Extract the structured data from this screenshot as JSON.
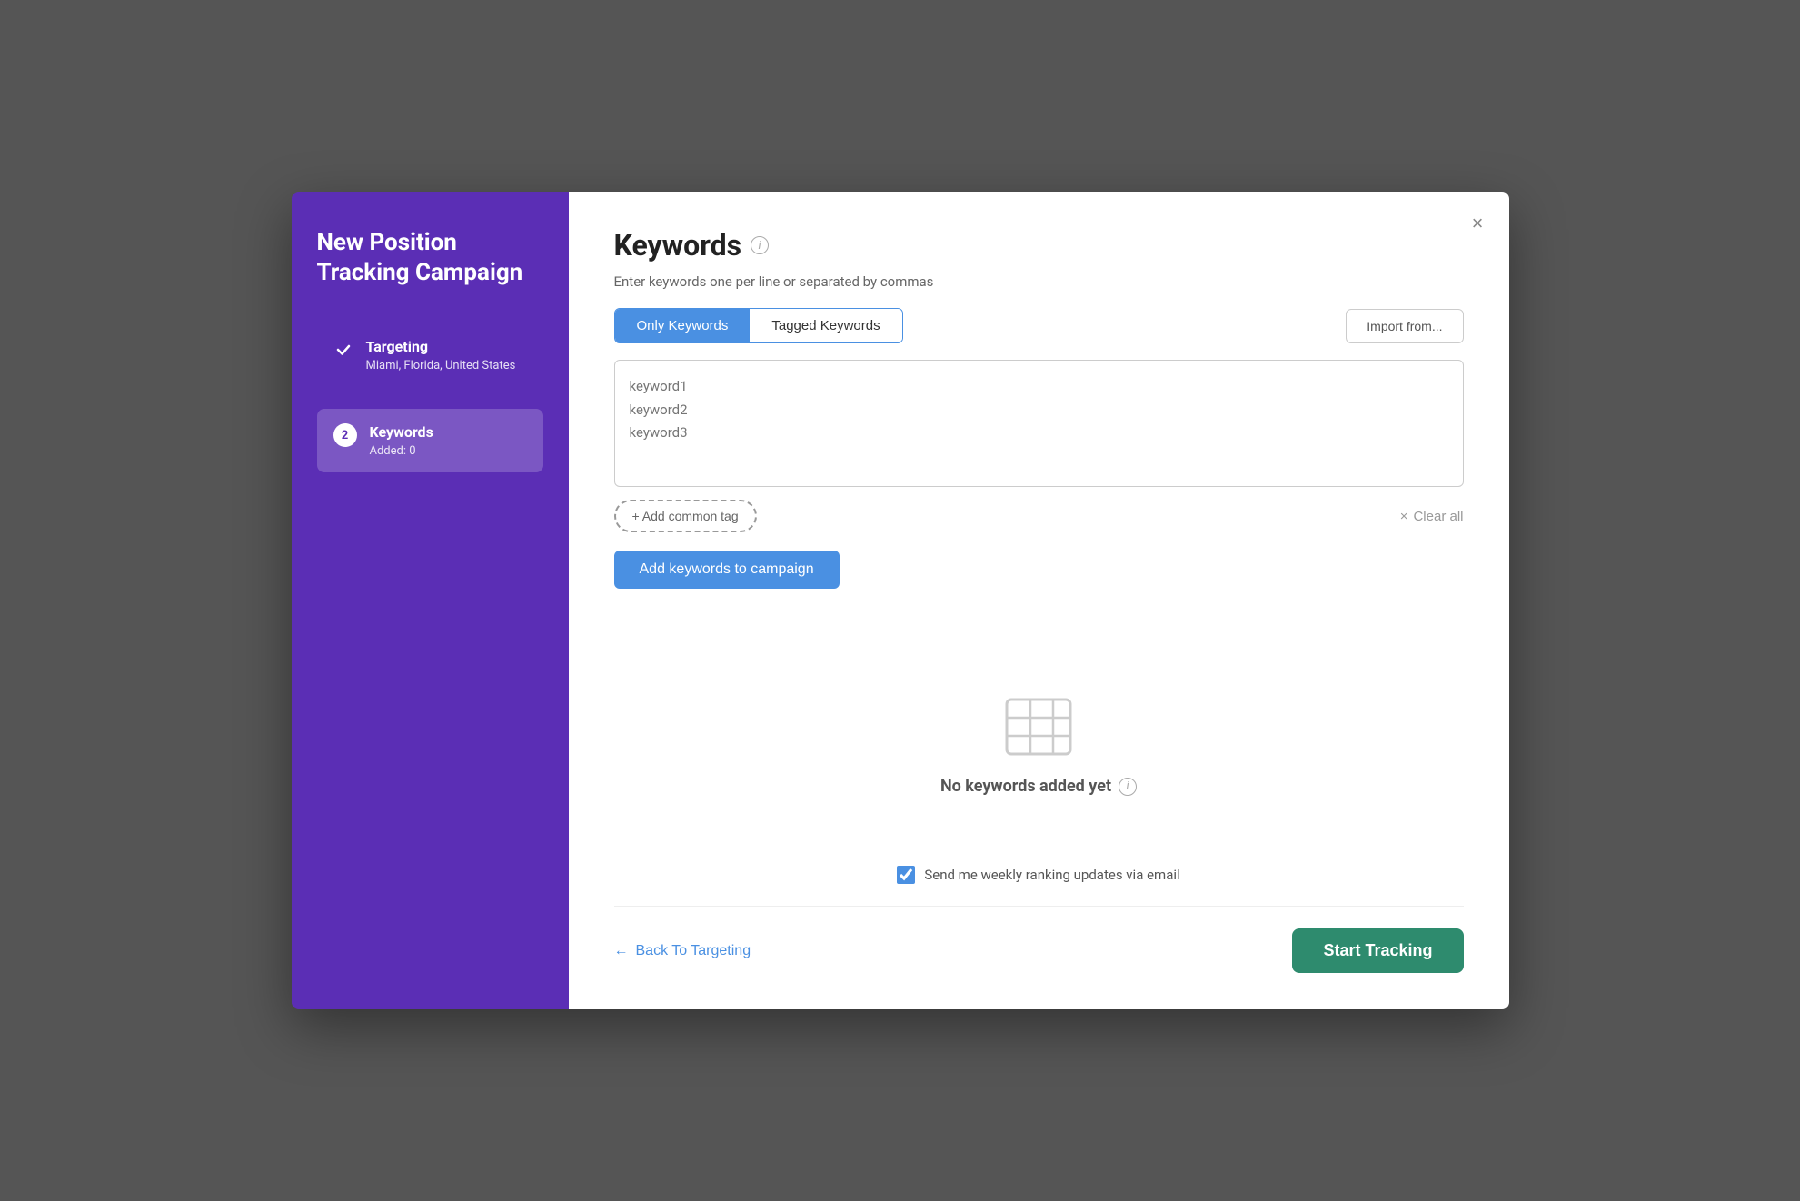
{
  "sidebar": {
    "title": "New Position Tracking Campaign",
    "steps": [
      {
        "id": "targeting",
        "label": "Targeting",
        "sublabel": "Miami, Florida, United States",
        "status": "completed",
        "number": null
      },
      {
        "id": "keywords",
        "label": "Keywords",
        "sublabel": "Added: 0",
        "status": "active",
        "number": "2"
      }
    ]
  },
  "main": {
    "title": "Keywords",
    "subtitle": "Enter keywords one per line or separated by commas",
    "tabs": [
      {
        "label": "Only Keywords",
        "active": true
      },
      {
        "label": "Tagged Keywords",
        "active": false
      }
    ],
    "import_button": "Import from...",
    "textarea_placeholder": "keyword1\nkeyword2\nkeyword3",
    "add_tag_label": "+ Add common tag",
    "clear_all_label": "Clear all",
    "add_keywords_label": "Add keywords to campaign",
    "empty_state": {
      "title": "No keywords added yet"
    },
    "checkbox_label": "Send me weekly ranking updates via email",
    "back_button": "Back To Targeting",
    "start_button": "Start Tracking",
    "close_label": "×"
  }
}
